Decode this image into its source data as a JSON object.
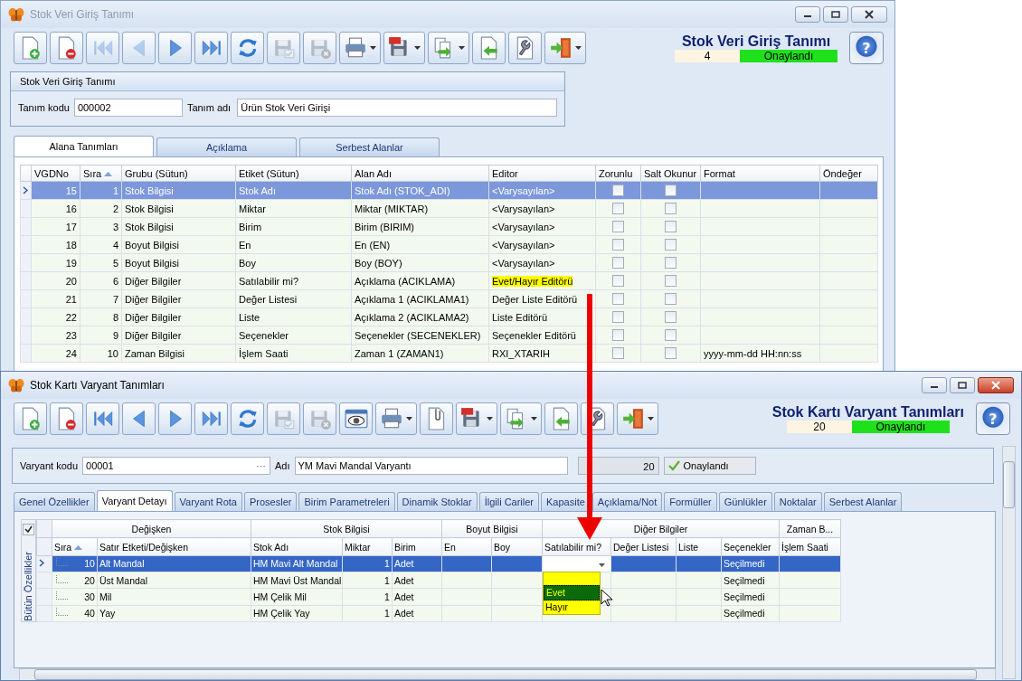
{
  "definition_window": {
    "title": "Stok Veri Giriş Tanımı",
    "active": false,
    "toolbar": [
      {
        "kind": "new",
        "disabled": false,
        "dropdown": false
      },
      {
        "kind": "delete",
        "disabled": false,
        "dropdown": false
      },
      {
        "kind": "first",
        "disabled": true,
        "dropdown": false
      },
      {
        "kind": "prev",
        "disabled": true,
        "dropdown": false
      },
      {
        "kind": "next",
        "disabled": false,
        "dropdown": false
      },
      {
        "kind": "last",
        "disabled": false,
        "dropdown": false
      },
      {
        "kind": "refresh",
        "disabled": false,
        "dropdown": false
      },
      {
        "kind": "save",
        "disabled": true,
        "dropdown": false
      },
      {
        "kind": "cancel",
        "disabled": true,
        "dropdown": false
      },
      {
        "kind": "print",
        "disabled": false,
        "dropdown": true
      },
      {
        "kind": "pdf",
        "disabled": false,
        "dropdown": true
      },
      {
        "kind": "export",
        "disabled": false,
        "dropdown": true
      },
      {
        "kind": "import",
        "disabled": false,
        "dropdown": false
      },
      {
        "kind": "tools",
        "disabled": false,
        "dropdown": false
      },
      {
        "kind": "exit",
        "disabled": false,
        "dropdown": true
      }
    ],
    "header_title": "Stok Veri Giriş Tanımı",
    "record_no": "4",
    "status": "Onaylandı",
    "help": "?",
    "panel_title": "Stok Veri Giriş Tanımı",
    "fields": [
      {
        "label": "Tanım kodu",
        "value": "000002"
      },
      {
        "label": "Tanım adı",
        "value": "Ürün Stok Veri Girişi"
      }
    ],
    "tabs": [
      {
        "label": "Alana Tanımları",
        "selected": true
      },
      {
        "label": "Açıklama",
        "selected": false
      },
      {
        "label": "Serbest Alanlar",
        "selected": false
      }
    ],
    "grid": {
      "columns": [
        {
          "label": "VGDNo",
          "sorted": false
        },
        {
          "label": "Sıra",
          "sorted": true
        },
        {
          "label": "Grubu (Sütun)",
          "sorted": false
        },
        {
          "label": "Etiket (Sütun)",
          "sorted": false
        },
        {
          "label": "Alan Adı",
          "sorted": false
        },
        {
          "label": "Editor",
          "sorted": false
        },
        {
          "label": "Zorunlu",
          "sorted": false
        },
        {
          "label": "Salt Okunur",
          "sorted": false
        },
        {
          "label": "Format",
          "sorted": false
        },
        {
          "label": "Öndeğer",
          "sorted": false
        }
      ],
      "rows": [
        {
          "cells": [
            "15",
            "1",
            "Stok Bilgisi",
            "Stok Adı",
            "Stok Adı (STOK_ADI)",
            "<Varysayılan>"
          ],
          "required": false,
          "read_only": false,
          "selected": true,
          "highlighted": false
        },
        {
          "cells": [
            "16",
            "2",
            "Stok Bilgisi",
            "Miktar",
            "Miktar (MIKTAR)",
            "<Varysayılan>"
          ],
          "required": false,
          "read_only": false,
          "selected": false,
          "highlighted": false
        },
        {
          "cells": [
            "17",
            "3",
            "Stok Bilgisi",
            "Birim",
            "Birim (BIRIM)",
            "<Varysayılan>"
          ],
          "required": false,
          "read_only": false,
          "selected": false,
          "highlighted": false
        },
        {
          "cells": [
            "18",
            "4",
            "Boyut Bilgisi",
            "En",
            "En (EN)",
            "<Varysayılan>"
          ],
          "required": false,
          "read_only": false,
          "selected": false,
          "highlighted": false
        },
        {
          "cells": [
            "19",
            "5",
            "Boyut Bilgisi",
            "Boy",
            "Boy (BOY)",
            "<Varysayılan>"
          ],
          "required": false,
          "read_only": false,
          "selected": false,
          "highlighted": false
        },
        {
          "cells": [
            "20",
            "6",
            "Diğer Bilgiler",
            "Satılabilir mi?",
            "Açıklama (ACIKLAMA)",
            "Evet/Hayır Editörü"
          ],
          "required": false,
          "read_only": false,
          "selected": false,
          "highlighted": true
        },
        {
          "cells": [
            "21",
            "7",
            "Diğer Bilgiler",
            "Değer Listesi",
            "Açıklama 1 (ACIKLAMA1)",
            "Değer Liste Editörü"
          ],
          "required": false,
          "read_only": false,
          "selected": false,
          "highlighted": false
        },
        {
          "cells": [
            "22",
            "8",
            "Diğer Bilgiler",
            "Liste",
            "Açıklama 2 (ACIKLAMA2)",
            "Liste Editörü"
          ],
          "required": false,
          "read_only": false,
          "selected": false,
          "highlighted": false
        },
        {
          "cells": [
            "23",
            "9",
            "Diğer Bilgiler",
            "Seçenekler",
            "Seçenekler (SECENEKLER)",
            "Seçenekler Editörü"
          ],
          "required": false,
          "read_only": false,
          "selected": false,
          "highlighted": false
        },
        {
          "cells": [
            "24",
            "10",
            "Zaman Bilgisi",
            "İşlem Saati",
            "Zaman 1 (ZAMAN1)",
            "RXI_XTARIH"
          ],
          "required": false,
          "read_only": false,
          "selected": false,
          "highlighted": false,
          "format": "yyyy-mm-dd HH:nn:ss"
        }
      ]
    }
  },
  "variant_window": {
    "title": "Stok Kartı Varyant Tanımları",
    "active": true,
    "toolbar": [
      {
        "kind": "new",
        "disabled": false,
        "dropdown": false
      },
      {
        "kind": "delete",
        "disabled": false,
        "dropdown": false
      },
      {
        "kind": "first",
        "disabled": false,
        "dropdown": false
      },
      {
        "kind": "prev",
        "disabled": false,
        "dropdown": false
      },
      {
        "kind": "next",
        "disabled": false,
        "dropdown": false
      },
      {
        "kind": "last",
        "disabled": false,
        "dropdown": false
      },
      {
        "kind": "refresh",
        "disabled": false,
        "dropdown": false
      },
      {
        "kind": "save",
        "disabled": true,
        "dropdown": false
      },
      {
        "kind": "cancel",
        "disabled": true,
        "dropdown": false
      },
      {
        "kind": "preview",
        "disabled": false,
        "dropdown": false
      },
      {
        "kind": "print",
        "disabled": false,
        "dropdown": true
      },
      {
        "kind": "attach",
        "disabled": false,
        "dropdown": false
      },
      {
        "kind": "pdf",
        "disabled": false,
        "dropdown": true
      },
      {
        "kind": "export",
        "disabled": false,
        "dropdown": true
      },
      {
        "kind": "import",
        "disabled": false,
        "dropdown": false
      },
      {
        "kind": "tools",
        "disabled": false,
        "dropdown": false
      },
      {
        "kind": "exit",
        "disabled": false,
        "dropdown": true
      }
    ],
    "header_title": "Stok Kartı Varyant Tanımları",
    "record_no": "20",
    "status": "Onaylandı",
    "help": "?",
    "fields": [
      {
        "label": "Varyant kodu",
        "value": "00001",
        "ellipsis": "···"
      },
      {
        "label": "Adı",
        "value": "YM Mavi Mandal Varyantı"
      }
    ],
    "count": "20",
    "approval": {
      "label": "Onaylandı",
      "checked": true
    },
    "tabs": [
      {
        "label": "Genel Özellikler",
        "selected": false
      },
      {
        "label": "Varyant Detayı",
        "selected": true
      },
      {
        "label": "Varyant Rota",
        "selected": false
      },
      {
        "label": "Prosesler",
        "selected": false
      },
      {
        "label": "Birim Parametreleri",
        "selected": false
      },
      {
        "label": "Dinamik Stoklar",
        "selected": false
      },
      {
        "label": "İlgili Cariler",
        "selected": false
      },
      {
        "label": "Kapasite",
        "selected": false
      },
      {
        "label": "Açıklama/Not",
        "selected": false
      },
      {
        "label": "Formüller",
        "selected": false
      },
      {
        "label": "Günlükler",
        "selected": false
      },
      {
        "label": "Noktalar",
        "selected": false
      },
      {
        "label": "Serbest Alanlar",
        "selected": false
      }
    ],
    "grid": {
      "select_all_checked": true,
      "side_label": "Bütün Özellikler",
      "bands": [
        {
          "label": "Değişken"
        },
        {
          "label": "Stok Bilgisi"
        },
        {
          "label": "Boyut Bilgisi"
        },
        {
          "label": "Diğer Bilgiler"
        },
        {
          "label": "Zaman B..."
        }
      ],
      "columns": [
        {
          "label": "Sıra",
          "sorted": true
        },
        {
          "label": "Satır Etketi/Değişken",
          "sorted": false
        },
        {
          "label": "Stok Adı",
          "sorted": false
        },
        {
          "label": "Miktar",
          "sorted": false
        },
        {
          "label": "Birim",
          "sorted": false
        },
        {
          "label": "En",
          "sorted": false
        },
        {
          "label": "Boy",
          "sorted": false
        },
        {
          "label": "Satılabilir mi?",
          "sorted": false
        },
        {
          "label": "Değer Listesi",
          "sorted": false
        },
        {
          "label": "Liste",
          "sorted": false
        },
        {
          "label": "Seçenekler",
          "sorted": false
        },
        {
          "label": "İşlem Saati",
          "sorted": false
        }
      ],
      "rows": [
        {
          "cells": [
            "10",
            "Alt Mandal",
            "HM Mavi Alt Mandal",
            "1",
            "Adet"
          ],
          "options": "Seçilmedi",
          "selected": true,
          "editing": true
        },
        {
          "cells": [
            "20",
            "Üst Mandal",
            "HM Mavi Üst Mandal",
            "1",
            "Adet"
          ],
          "options": "Seçilmedi",
          "selected": false,
          "editing": false
        },
        {
          "cells": [
            "30",
            "Mil",
            "HM Çelik Mil",
            "1",
            "Adet"
          ],
          "options": "Seçilmedi",
          "selected": false,
          "editing": false
        },
        {
          "cells": [
            "40",
            "Yay",
            "HM Çelik Yay",
            "1",
            "Adet"
          ],
          "options": "Seçilmedi",
          "selected": false,
          "editing": false
        }
      ],
      "dropdown": {
        "items": [
          {
            "label": "Evet",
            "selected": true
          },
          {
            "label": "Hayır",
            "selected": false
          }
        ]
      }
    }
  }
}
